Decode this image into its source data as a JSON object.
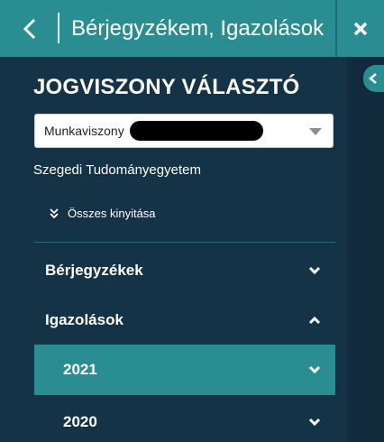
{
  "header": {
    "title": "Bérjegyzékem, Igazolások",
    "back_icon": "chevron-left-icon",
    "close_icon": "close-icon"
  },
  "panel": {
    "section_title": "JOGVISZONY VÁLASZTÓ",
    "relationship_select": {
      "value": "Munkaviszony",
      "redacted": true
    },
    "organization": "Szegedi Tudományegyetem",
    "expand_all_label": "Összes kinyitása",
    "menu": [
      {
        "label": "Bérjegyzékek",
        "state": "collapsed"
      },
      {
        "label": "Igazolások",
        "state": "expanded"
      },
      {
        "label": "2021",
        "state": "collapsed",
        "active": true
      },
      {
        "label": "2020",
        "state": "collapsed"
      }
    ]
  },
  "colors": {
    "header_bg": "#2a8d92",
    "panel_bg": "#143347",
    "active_row_bg": "#2a8d92",
    "text": "#ffffff"
  }
}
